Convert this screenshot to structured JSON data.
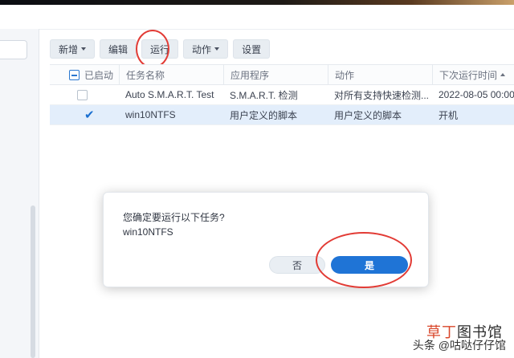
{
  "toolbar": {
    "add_label": "新增",
    "edit_label": "编辑",
    "run_label": "运行",
    "action_label": "动作",
    "settings_label": "设置"
  },
  "table": {
    "headers": [
      "已启动",
      "任务名称",
      "应用程序",
      "动作",
      "下次运行时间"
    ],
    "rows": [
      {
        "enabled": false,
        "task": "Auto S.M.A.R.T. Test",
        "app": "S.M.A.R.T. 检测",
        "action": "对所有支持快速检测...",
        "next_run": "2022-08-05 00:00"
      },
      {
        "enabled": true,
        "task": "win10NTFS",
        "app": "用户定义的脚本",
        "action": "用户定义的脚本",
        "next_run": "开机"
      }
    ]
  },
  "dialog": {
    "question": "您确定要运行以下任务?",
    "task_name": "win10NTFS",
    "no_label": "否",
    "yes_label": "是"
  },
  "watermark": {
    "brand_accent": "草丁",
    "brand_rest": "图书馆",
    "sub": "头条 @咕哒仔仔馆"
  },
  "colors": {
    "primary": "#1f74d6",
    "selected_row": "#e3eefb",
    "annotation": "#e23b35"
  }
}
